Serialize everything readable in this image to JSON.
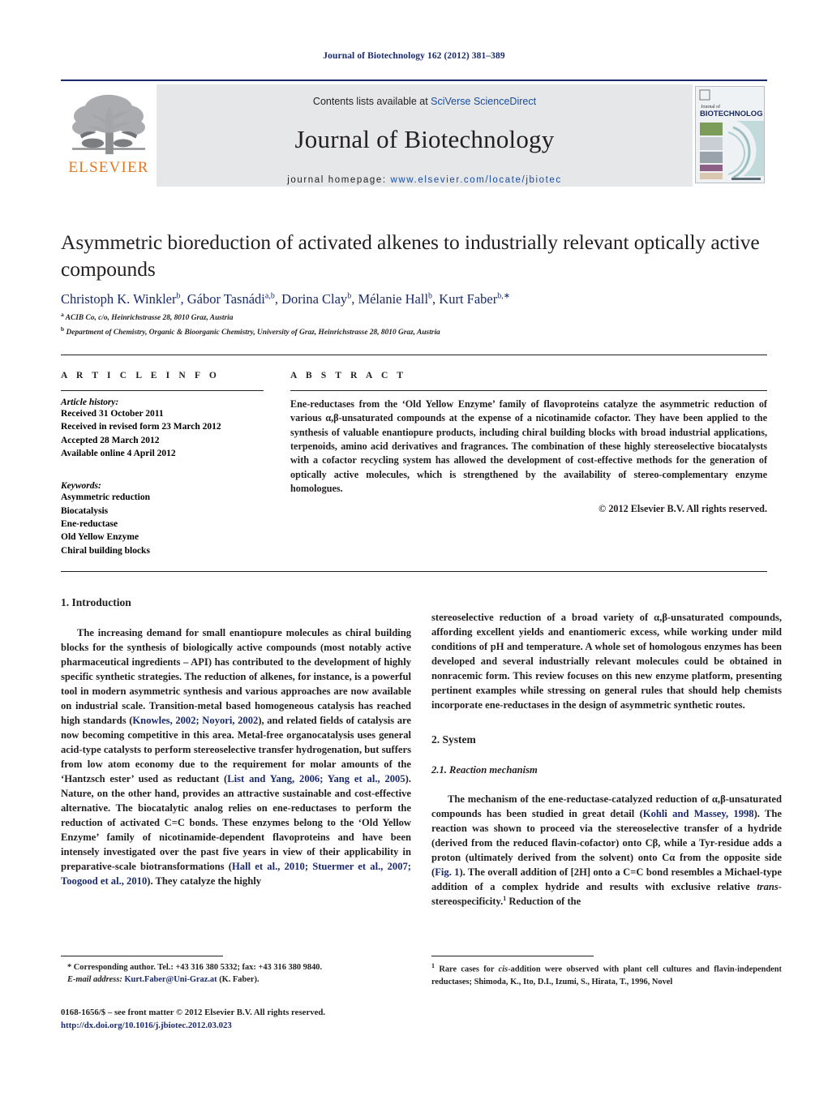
{
  "running_head": "Journal of Biotechnology 162 (2012) 381–389",
  "masthead": {
    "contents_prefix": "Contents lists available at ",
    "contents_link": "SciVerse ScienceDirect",
    "journal_name": "Journal of Biotechnology",
    "homepage_prefix": "journal homepage: ",
    "homepage_url": "www.elsevier.com/locate/jbiotec",
    "publisher_wordmark": "ELSEVIER",
    "cover_title_small": "Journal of",
    "cover_title_large": "BIOTECHNOLOGY",
    "accent_orange": "#e87722",
    "accent_blue": "#1a4c9c",
    "header_blue": "#1a2a6c",
    "panel_grey": "#e6e7e9"
  },
  "article": {
    "title": "Asymmetric bioreduction of activated alkenes to industrially relevant optically active compounds",
    "authors_html": "Christoph K. Winkler<sup>b</sup>, Gábor Tasnádi<sup>a,b</sup>, Dorina Clay<sup>b</sup>, Mélanie Hall<sup>b</sup>, Kurt Faber<sup>b,∗</sup>",
    "affiliations": [
      {
        "marker": "a",
        "text": "ACIB Co, c/o, Heinrichstrasse 28, 8010 Graz, Austria"
      },
      {
        "marker": "b",
        "text": "Department of Chemistry, Organic & Bioorganic Chemistry, University of Graz, Heinrichstrasse 28, 8010 Graz, Austria"
      }
    ]
  },
  "article_info": {
    "heading": "A R T I C L E    I N F O",
    "history_label": "Article history:",
    "history": [
      "Received 31 October 2011",
      "Received in revised form 23 March 2012",
      "Accepted 28 March 2012",
      "Available online 4 April 2012"
    ],
    "keywords_label": "Keywords:",
    "keywords": [
      "Asymmetric reduction",
      "Biocatalysis",
      "Ene-reductase",
      "Old Yellow Enzyme",
      "Chiral building blocks"
    ]
  },
  "abstract": {
    "heading": "A B S T R A C T",
    "text": "Ene-reductases from the ‘Old Yellow Enzyme’ family of flavoproteins catalyze the asymmetric reduction of various α,β-unsaturated compounds at the expense of a nicotinamide cofactor. They have been applied to the synthesis of valuable enantiopure products, including chiral building blocks with broad industrial applications, terpenoids, amino acid derivatives and fragrances. The combination of these highly stereoselective biocatalysts with a cofactor recycling system has allowed the development of cost-effective methods for the generation of optically active molecules, which is strengthened by the availability of stereo-complementary enzyme homologues.",
    "copyright": "© 2012 Elsevier B.V. All rights reserved."
  },
  "body": {
    "left": {
      "section_heading": "1.  Introduction",
      "paragraph_html": "The increasing demand for small enantiopure molecules as chiral building blocks for the synthesis of biologically active compounds (most notably active pharmaceutical ingredients – API) has contributed to the development of highly specific synthetic strategies. The reduction of alkenes, for instance, is a powerful tool in modern asymmetric synthesis and various approaches are now available on industrial scale. Transition-metal based homogeneous catalysis has reached high standards (<span class=\"cite\">Knowles, 2002; Noyori, 2002</span>), and related fields of catalysis are now becoming competitive in this area. Metal-free organocatalysis uses general acid-type catalysts to perform stereoselective transfer hydrogenation, but suffers from low atom economy due to the requirement for molar amounts of the ‘Hantzsch ester’ used as reductant (<span class=\"cite\">List and Yang, 2006; Yang et al., 2005</span>). Nature, on the other hand, provides an attractive sustainable and cost-effective alternative. The biocatalytic analog relies on ene-reductases to perform the reduction of activated C&#61;C bonds. These enzymes belong to the ‘Old Yellow Enzyme’ family of nicotinamide-dependent flavoproteins and have been intensely investigated over the past five years in view of their applicability in preparative-scale biotransformations (<span class=\"cite\">Hall et al., 2010; Stuermer et al., 2007; Toogood et al., 2010</span>). They catalyze the highly"
    },
    "right": {
      "continuation_html": "stereoselective reduction of a broad variety of α,β-unsaturated compounds, affording excellent yields and enantiomeric excess, while working under mild conditions of pH and temperature. A whole set of homologous enzymes has been developed and several industrially relevant molecules could be obtained in nonracemic form. This review focuses on this new enzyme platform, presenting pertinent examples while stressing on general rules that should help chemists incorporate ene-reductases in the design of asymmetric synthetic routes.",
      "section_heading": "2.  System",
      "subsection_heading": "2.1.  Reaction mechanism",
      "paragraph_html": "The mechanism of the ene-reductase-catalyzed reduction of α,β-unsaturated compounds has been studied in great detail (<span class=\"cite\">Kohli and Massey, 1998</span>). The reaction was shown to proceed via the stereoselective transfer of a hydride (derived from the reduced flavin-cofactor) onto Cβ, while a Tyr-residue adds a proton (ultimately derived from the solvent) onto Cα from the opposite side (<span class=\"cite\">Fig. 1</span>). The overall addition of [2H] onto a C&#61;C bond resembles a Michael-type addition of a complex hydride and results with exclusive relative <i>trans</i>-stereospecificity.<sup class=\"fn\">1</sup> Reduction of the"
    }
  },
  "footnotes": {
    "corresponding_html": "<b>*</b> Corresponding author. Tel.: +43 316 380 5332; fax: +43 316 380 9840.",
    "email_label": "E-mail address:",
    "email": "Kurt.Faber@Uni-Graz.at",
    "email_suffix": "(K. Faber).",
    "note_1_html": "<sup class=\"fn\">1</sup> Rare cases for <i>cis</i>-addition were observed with plant cell cultures and flavin-independent reductases; Shimoda, K., Ito, D.I., Izumi, S., Hirata, T., 1996, Novel"
  },
  "imprint": {
    "line1": "0168-1656/$ – see front matter © 2012 Elsevier B.V. All rights reserved.",
    "doi": "http://dx.doi.org/10.1016/j.jbiotec.2012.03.023"
  }
}
